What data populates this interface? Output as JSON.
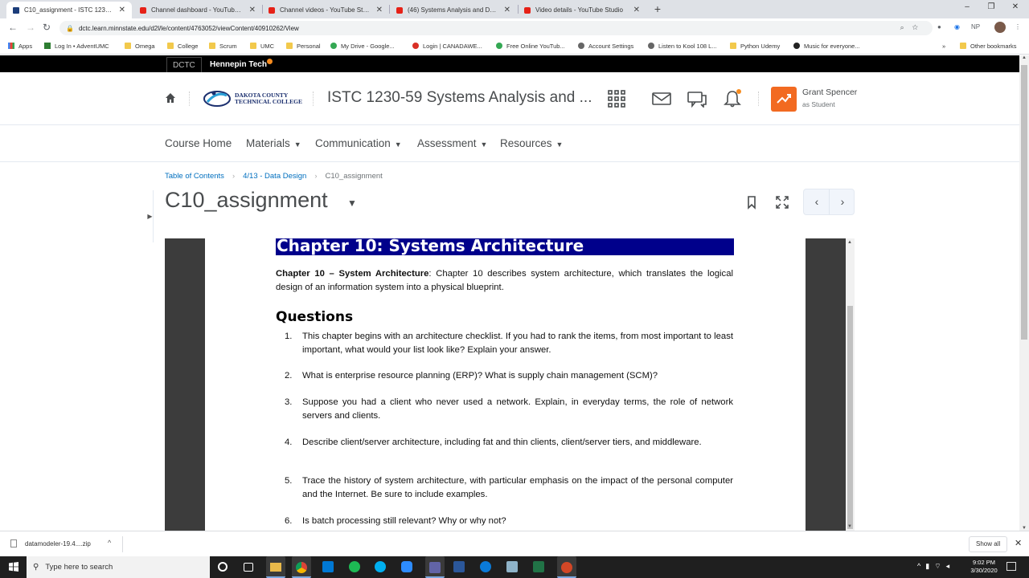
{
  "browser": {
    "tabs": [
      {
        "title": "C10_assignment - ISTC 1230-59 Sy",
        "icon": "d2l-icon",
        "active": true
      },
      {
        "title": "Channel dashboard - YouTube Studi",
        "icon": "youtube-icon",
        "active": false
      },
      {
        "title": "Channel videos - YouTube Studio",
        "icon": "youtube-icon",
        "active": false
      },
      {
        "title": "(46) Systems Analysis and Design",
        "icon": "youtube-icon",
        "active": false
      },
      {
        "title": "Video details - YouTube Studio",
        "icon": "youtube-icon",
        "active": false
      }
    ],
    "new_tab": "+",
    "url": "dctc.learn.minnstate.edu/d2l/le/content/4763052/viewContent/40910262/View",
    "profile_initials": "NP",
    "bookmarks": [
      {
        "label": "Apps",
        "icon": "grid"
      },
      {
        "label": "Log In • AdventUMC",
        "icon": "green"
      },
      {
        "label": "Omega",
        "icon": "folder"
      },
      {
        "label": "College",
        "icon": "folder"
      },
      {
        "label": "Scrum",
        "icon": "folder"
      },
      {
        "label": "UMC",
        "icon": "folder"
      },
      {
        "label": "Personal",
        "icon": "folder"
      },
      {
        "label": "My Drive - Google...",
        "icon": "tri"
      },
      {
        "label": "Login | CANADAWE...",
        "icon": "red"
      },
      {
        "label": "Free Online YouTub...",
        "icon": "tri"
      },
      {
        "label": "Account Settings",
        "icon": "gray"
      },
      {
        "label": "Listen to Kool 108 L...",
        "icon": "gray"
      },
      {
        "label": "Python Udemy",
        "icon": "folder"
      },
      {
        "label": "Music for everyone...",
        "icon": "dark"
      }
    ],
    "more_bookmarks": "»",
    "other_bookmarks": "Other bookmarks"
  },
  "org": {
    "dctc": "DCTC",
    "hennepin": "Hennepin Tech"
  },
  "header": {
    "logo_line1": "DAKOTA COUNTY",
    "logo_line2": "TECHNICAL COLLEGE",
    "course_title": "ISTC 1230-59 Systems Analysis and ...",
    "user_name": "Grant Spencer",
    "user_role": "as Student"
  },
  "nav": {
    "items": [
      {
        "label": "Course Home",
        "dropdown": false
      },
      {
        "label": "Materials",
        "dropdown": true
      },
      {
        "label": "Communication",
        "dropdown": true
      },
      {
        "label": "Assessment",
        "dropdown": true
      },
      {
        "label": "Resources",
        "dropdown": true
      }
    ]
  },
  "breadcrumb": {
    "items": [
      "Table of Contents",
      "4/13 - Data Design",
      "C10_assignment"
    ]
  },
  "page": {
    "title": "C10_assignment"
  },
  "document": {
    "chapter_heading": "Chapter 10: Systems Architecture",
    "intro_bold": "Chapter 10 – System Architecture",
    "intro_text": ": Chapter 10 describes system architecture, which translates the logical design of an information system into a physical blueprint.",
    "questions_heading": "Questions",
    "questions": [
      {
        "num": "1.",
        "text": "This chapter begins with an architecture checklist. If you had to rank the items, from most important to least important, what would your list look like? Explain your answer."
      },
      {
        "num": "2.",
        "text": "What is enterprise resource planning (ERP)? What is supply chain management (SCM)?"
      },
      {
        "num": "3.",
        "text": "Suppose you had a client who never used a network. Explain, in everyday terms, the role of network servers and clients."
      },
      {
        "num": "4.",
        "text": "Describe client/server architecture, including fat and thin clients, client/server tiers, and middleware."
      },
      {
        "num": "5.",
        "text": "Trace the history of system architecture, with particular emphasis on the impact of the personal computer and the Internet. Be sure to include examples."
      },
      {
        "num": "6.",
        "text": "Is batch processing still relevant? Why or why not?"
      }
    ]
  },
  "downloads": {
    "file": "datamodeler-19.4....zip",
    "show_all": "Show all"
  },
  "taskbar": {
    "search_placeholder": "Type here to search",
    "time": "9:02 PM",
    "date": "3/30/2020"
  },
  "colors": {
    "accent_orange": "#f26a21",
    "link_blue": "#006fbf",
    "chapter_bar": "#00008b"
  }
}
